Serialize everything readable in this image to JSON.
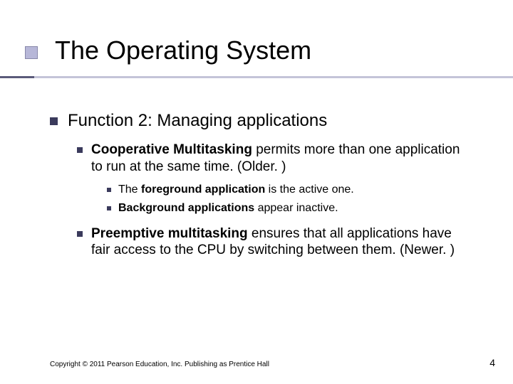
{
  "title": "The Operating System",
  "lvl1": "Function 2: Managing applications",
  "coop": {
    "bold": "Cooperative Multitasking",
    "rest": " permits more than one application to run at the same time. (Older. )"
  },
  "fg": {
    "pre": "The ",
    "bold": "foreground application",
    "rest": " is the active one."
  },
  "bg": {
    "bold": "Background applications",
    "rest": " appear inactive."
  },
  "preempt": {
    "bold": "Preemptive multitasking",
    "rest": " ensures that all applications have fair access to the CPU by switching between them. (Newer. )"
  },
  "footer": "Copyright © 2011 Pearson Education, Inc. Publishing as Prentice Hall",
  "page": "4"
}
